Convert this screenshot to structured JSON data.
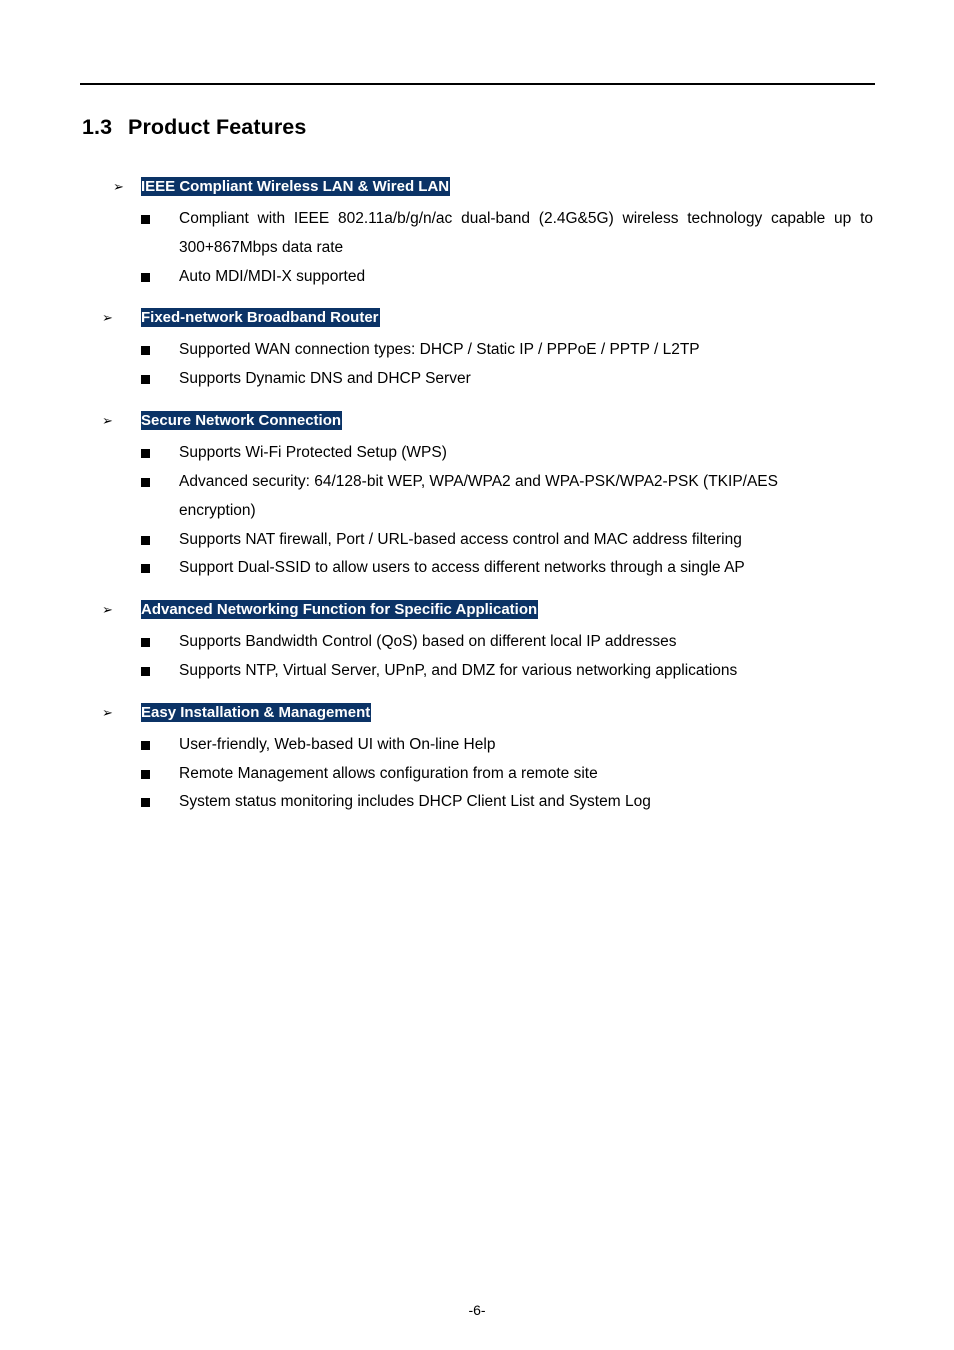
{
  "section": {
    "number": "1.3",
    "title": "Product Features"
  },
  "groups": [
    {
      "heading": "IEEE Compliant Wireless LAN & Wired LAN",
      "items": [
        "Compliant with IEEE 802.11a/b/g/n/ac dual-band (2.4G&5G) wireless technology capable up to 300+867Mbps data rate",
        "Auto MDI/MDI-X supported"
      ]
    },
    {
      "heading": "Fixed-network Broadband Router",
      "items": [
        "Supported WAN connection types: DHCP / Static IP / PPPoE / PPTP / L2TP",
        "Supports Dynamic DNS and DHCP Server"
      ]
    },
    {
      "heading": "Secure Network Connection",
      "items": [
        "Supports Wi-Fi Protected Setup (WPS)",
        "Advanced security: 64/128-bit WEP, WPA/WPA2 and WPA-PSK/WPA2-PSK (TKIP/AES encryption)",
        "Supports NAT firewall, Port / URL-based access control and MAC address filtering",
        "Support Dual-SSID to allow users to access different networks through a single AP"
      ]
    },
    {
      "heading": "Advanced Networking Function for Specific Application",
      "items": [
        "Supports Bandwidth Control (QoS) based on different local IP addresses",
        "Supports NTP, Virtual Server, UPnP, and DMZ for various networking applications"
      ]
    },
    {
      "heading": "Easy Installation & Management",
      "items": [
        "User-friendly, Web-based UI with On-line Help",
        "Remote Management allows configuration from a remote site",
        "System status monitoring includes DHCP Client List and System Log"
      ]
    }
  ],
  "icons": {
    "group_marker": "arrowhead-bullet-icon",
    "item_marker": "square-bullet-icon"
  },
  "colors": {
    "heading_highlight": "#0b3366",
    "heading_text": "#ffffff"
  },
  "footer": {
    "page_number": "-6-"
  }
}
